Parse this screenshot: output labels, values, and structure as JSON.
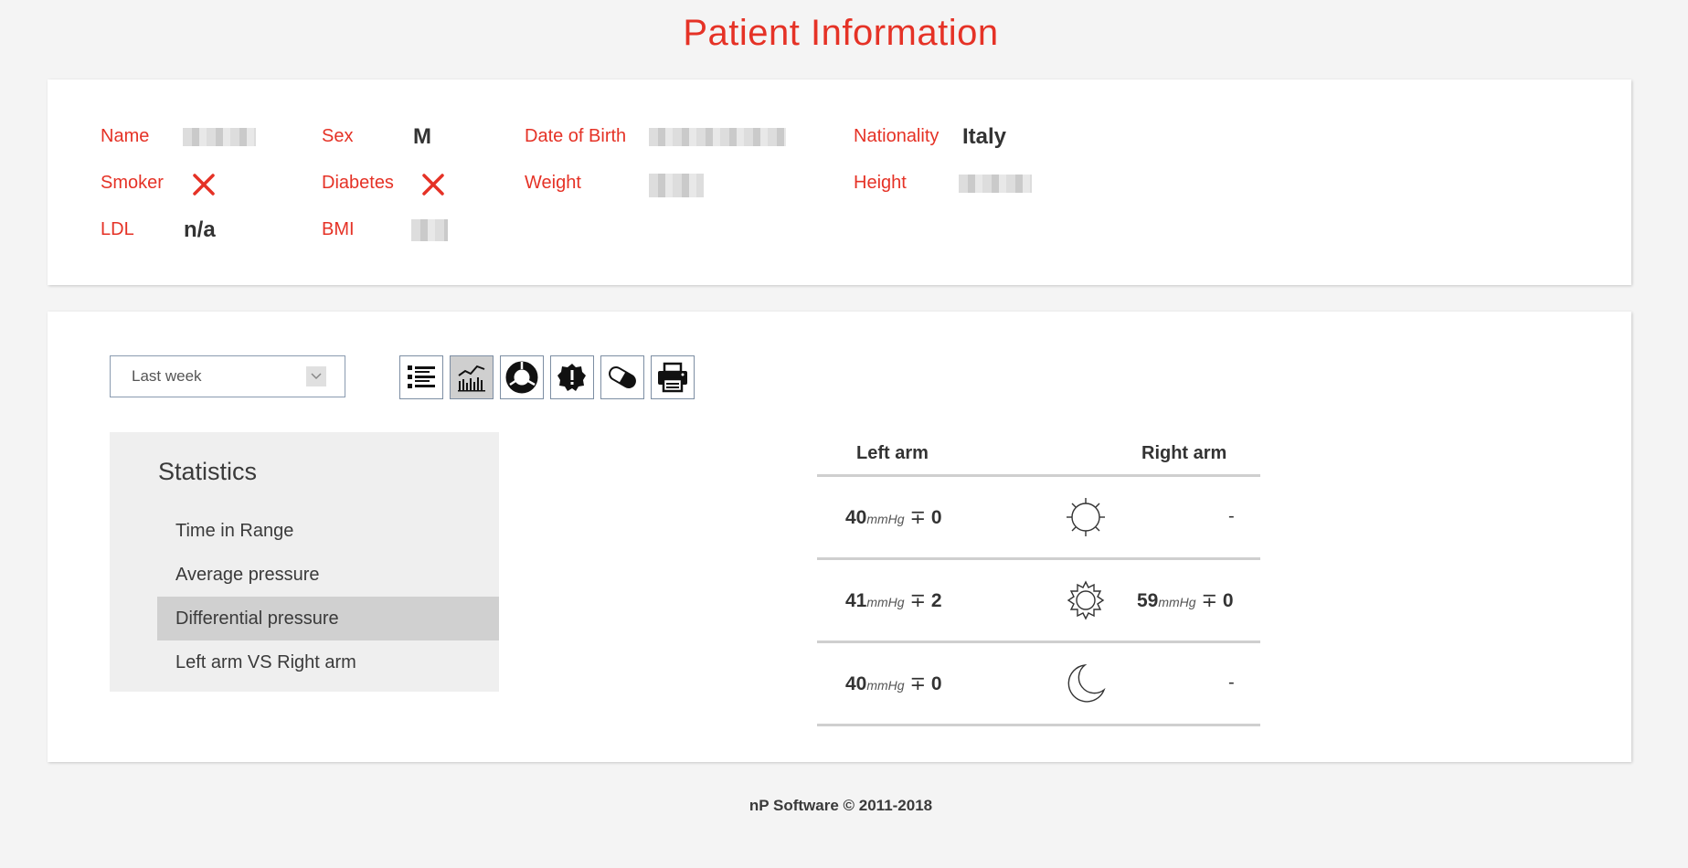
{
  "page": {
    "title": "Patient Information"
  },
  "patient": {
    "name_label": "Name",
    "sex_label": "Sex",
    "sex_value": "M",
    "dob_label": "Date of Birth",
    "nationality_label": "Nationality",
    "nationality_value": "Italy",
    "smoker_label": "Smoker",
    "smoker_value": false,
    "diabetes_label": "Diabetes",
    "diabetes_value": false,
    "weight_label": "Weight",
    "height_label": "Height",
    "ldl_label": "LDL",
    "ldl_value": "n/a",
    "bmi_label": "BMI",
    "redacted_fields": [
      "name",
      "date_of_birth",
      "weight",
      "height",
      "bmi"
    ]
  },
  "controls": {
    "period_select": {
      "value": "Last week"
    },
    "toolbar": [
      {
        "id": "list",
        "icon": "list-icon",
        "active": false
      },
      {
        "id": "chart",
        "icon": "line-chart-icon",
        "active": true
      },
      {
        "id": "donut",
        "icon": "donut-chart-icon",
        "active": false
      },
      {
        "id": "alert",
        "icon": "alert-badge-icon",
        "active": false
      },
      {
        "id": "pill",
        "icon": "pill-icon",
        "active": false
      },
      {
        "id": "print",
        "icon": "printer-icon",
        "active": false
      }
    ]
  },
  "statistics": {
    "title": "Statistics",
    "items": [
      {
        "label": "Time in Range",
        "selected": false
      },
      {
        "label": "Average pressure",
        "selected": false
      },
      {
        "label": "Differential pressure",
        "selected": true
      },
      {
        "label": "Left arm VS Right arm",
        "selected": false
      }
    ]
  },
  "bp_table": {
    "left_header": "Left arm",
    "right_header": "Right arm",
    "unit": "mmHg",
    "pm_symbol": "∓",
    "rows": [
      {
        "period_icon": "sun-icon",
        "left_value": "40",
        "left_dev": "0",
        "right": "-"
      },
      {
        "period_icon": "sun-full-icon",
        "left_value": "41",
        "left_dev": "2",
        "right_value": "59",
        "right_dev": "0"
      },
      {
        "period_icon": "moon-icon",
        "left_value": "40",
        "left_dev": "0",
        "right": "-"
      }
    ]
  },
  "footer": {
    "text": "nP Software © 2011-2018"
  },
  "colors": {
    "accent": "#e53226",
    "background": "#f4f4f4",
    "selected": "#d0d0d0"
  }
}
